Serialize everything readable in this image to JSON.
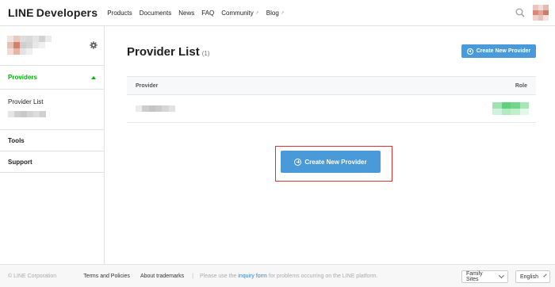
{
  "header": {
    "logo_line": "LINE",
    "logo_dev": "Developers",
    "nav": [
      {
        "label": "Products",
        "external": false
      },
      {
        "label": "Documents",
        "external": false
      },
      {
        "label": "News",
        "external": false
      },
      {
        "label": "FAQ",
        "external": false
      },
      {
        "label": "Community",
        "external": true
      },
      {
        "label": "Blog",
        "external": true
      }
    ],
    "icons": {
      "search": "search-icon",
      "external": "external-link-icon"
    }
  },
  "sidebar": {
    "section_title": "Providers",
    "sub_item": "Provider List",
    "items": [
      "Tools",
      "Support"
    ],
    "accent": "#00b900"
  },
  "main": {
    "title": "Provider List",
    "count": "(1)",
    "create_button_small": "Create New Provider",
    "table": {
      "col_provider": "Provider",
      "col_role": "Role"
    },
    "create_button_large": "Create New Provider",
    "button_color": "#4a9ad9",
    "highlight_color": "#e0322e"
  },
  "footer": {
    "copyright": "© LINE Corporation",
    "terms": "Terms and Policies",
    "trademarks": "About trademarks",
    "separator": "|",
    "notice_pre": "Please use the",
    "notice_link": "inquiry form",
    "notice_post": "for problems occurring on the LINE platform.",
    "family_sites": "Family Sites",
    "language": "English"
  }
}
